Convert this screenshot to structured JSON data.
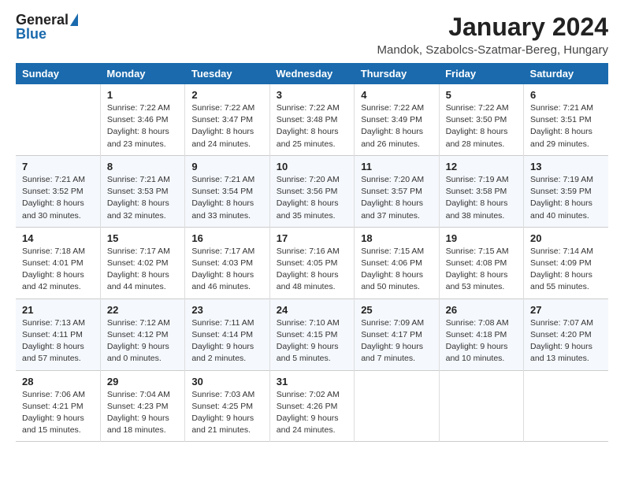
{
  "logo": {
    "general": "General",
    "blue": "Blue"
  },
  "title": "January 2024",
  "location": "Mandok, Szabolcs-Szatmar-Bereg, Hungary",
  "days_of_week": [
    "Sunday",
    "Monday",
    "Tuesday",
    "Wednesday",
    "Thursday",
    "Friday",
    "Saturday"
  ],
  "weeks": [
    [
      {
        "day": "",
        "info": ""
      },
      {
        "day": "1",
        "info": "Sunrise: 7:22 AM\nSunset: 3:46 PM\nDaylight: 8 hours\nand 23 minutes."
      },
      {
        "day": "2",
        "info": "Sunrise: 7:22 AM\nSunset: 3:47 PM\nDaylight: 8 hours\nand 24 minutes."
      },
      {
        "day": "3",
        "info": "Sunrise: 7:22 AM\nSunset: 3:48 PM\nDaylight: 8 hours\nand 25 minutes."
      },
      {
        "day": "4",
        "info": "Sunrise: 7:22 AM\nSunset: 3:49 PM\nDaylight: 8 hours\nand 26 minutes."
      },
      {
        "day": "5",
        "info": "Sunrise: 7:22 AM\nSunset: 3:50 PM\nDaylight: 8 hours\nand 28 minutes."
      },
      {
        "day": "6",
        "info": "Sunrise: 7:21 AM\nSunset: 3:51 PM\nDaylight: 8 hours\nand 29 minutes."
      }
    ],
    [
      {
        "day": "7",
        "info": "Sunrise: 7:21 AM\nSunset: 3:52 PM\nDaylight: 8 hours\nand 30 minutes."
      },
      {
        "day": "8",
        "info": "Sunrise: 7:21 AM\nSunset: 3:53 PM\nDaylight: 8 hours\nand 32 minutes."
      },
      {
        "day": "9",
        "info": "Sunrise: 7:21 AM\nSunset: 3:54 PM\nDaylight: 8 hours\nand 33 minutes."
      },
      {
        "day": "10",
        "info": "Sunrise: 7:20 AM\nSunset: 3:56 PM\nDaylight: 8 hours\nand 35 minutes."
      },
      {
        "day": "11",
        "info": "Sunrise: 7:20 AM\nSunset: 3:57 PM\nDaylight: 8 hours\nand 37 minutes."
      },
      {
        "day": "12",
        "info": "Sunrise: 7:19 AM\nSunset: 3:58 PM\nDaylight: 8 hours\nand 38 minutes."
      },
      {
        "day": "13",
        "info": "Sunrise: 7:19 AM\nSunset: 3:59 PM\nDaylight: 8 hours\nand 40 minutes."
      }
    ],
    [
      {
        "day": "14",
        "info": "Sunrise: 7:18 AM\nSunset: 4:01 PM\nDaylight: 8 hours\nand 42 minutes."
      },
      {
        "day": "15",
        "info": "Sunrise: 7:17 AM\nSunset: 4:02 PM\nDaylight: 8 hours\nand 44 minutes."
      },
      {
        "day": "16",
        "info": "Sunrise: 7:17 AM\nSunset: 4:03 PM\nDaylight: 8 hours\nand 46 minutes."
      },
      {
        "day": "17",
        "info": "Sunrise: 7:16 AM\nSunset: 4:05 PM\nDaylight: 8 hours\nand 48 minutes."
      },
      {
        "day": "18",
        "info": "Sunrise: 7:15 AM\nSunset: 4:06 PM\nDaylight: 8 hours\nand 50 minutes."
      },
      {
        "day": "19",
        "info": "Sunrise: 7:15 AM\nSunset: 4:08 PM\nDaylight: 8 hours\nand 53 minutes."
      },
      {
        "day": "20",
        "info": "Sunrise: 7:14 AM\nSunset: 4:09 PM\nDaylight: 8 hours\nand 55 minutes."
      }
    ],
    [
      {
        "day": "21",
        "info": "Sunrise: 7:13 AM\nSunset: 4:11 PM\nDaylight: 8 hours\nand 57 minutes."
      },
      {
        "day": "22",
        "info": "Sunrise: 7:12 AM\nSunset: 4:12 PM\nDaylight: 9 hours\nand 0 minutes."
      },
      {
        "day": "23",
        "info": "Sunrise: 7:11 AM\nSunset: 4:14 PM\nDaylight: 9 hours\nand 2 minutes."
      },
      {
        "day": "24",
        "info": "Sunrise: 7:10 AM\nSunset: 4:15 PM\nDaylight: 9 hours\nand 5 minutes."
      },
      {
        "day": "25",
        "info": "Sunrise: 7:09 AM\nSunset: 4:17 PM\nDaylight: 9 hours\nand 7 minutes."
      },
      {
        "day": "26",
        "info": "Sunrise: 7:08 AM\nSunset: 4:18 PM\nDaylight: 9 hours\nand 10 minutes."
      },
      {
        "day": "27",
        "info": "Sunrise: 7:07 AM\nSunset: 4:20 PM\nDaylight: 9 hours\nand 13 minutes."
      }
    ],
    [
      {
        "day": "28",
        "info": "Sunrise: 7:06 AM\nSunset: 4:21 PM\nDaylight: 9 hours\nand 15 minutes."
      },
      {
        "day": "29",
        "info": "Sunrise: 7:04 AM\nSunset: 4:23 PM\nDaylight: 9 hours\nand 18 minutes."
      },
      {
        "day": "30",
        "info": "Sunrise: 7:03 AM\nSunset: 4:25 PM\nDaylight: 9 hours\nand 21 minutes."
      },
      {
        "day": "31",
        "info": "Sunrise: 7:02 AM\nSunset: 4:26 PM\nDaylight: 9 hours\nand 24 minutes."
      },
      {
        "day": "",
        "info": ""
      },
      {
        "day": "",
        "info": ""
      },
      {
        "day": "",
        "info": ""
      }
    ]
  ]
}
